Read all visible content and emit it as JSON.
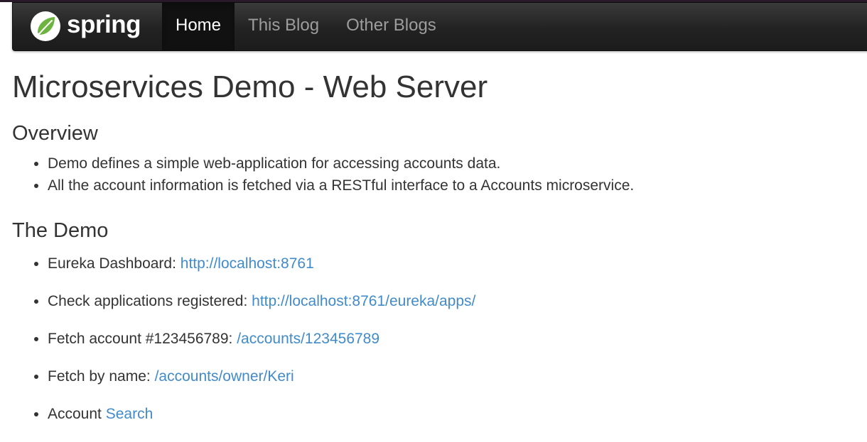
{
  "navbar": {
    "brand": "spring",
    "items": [
      {
        "label": "Home",
        "active": true
      },
      {
        "label": "This Blog",
        "active": false
      },
      {
        "label": "Other Blogs",
        "active": false
      }
    ]
  },
  "page": {
    "title": "Microservices Demo - Web Server"
  },
  "overview": {
    "heading": "Overview",
    "items": [
      "Demo defines a simple web-application for accessing accounts data.",
      "All the account information is fetched via a RESTful interface to a Accounts microservice."
    ]
  },
  "demo": {
    "heading": "The Demo",
    "items": [
      {
        "prefix": "Eureka Dashboard: ",
        "link": "http://localhost:8761"
      },
      {
        "prefix": "Check applications registered: ",
        "link": "http://localhost:8761/eureka/apps/"
      },
      {
        "prefix": "Fetch account #123456789: ",
        "link": "/accounts/123456789"
      },
      {
        "prefix": "Fetch by name: ",
        "link": "/accounts/owner/Keri"
      },
      {
        "prefix": "Account ",
        "link": "Search"
      }
    ]
  },
  "colors": {
    "link": "#428bca",
    "text": "#333333",
    "navbar": "#222222",
    "nav_inactive": "#9d9d9d",
    "brand_leaf": "#6db33f"
  },
  "icons": {
    "brand": "spring-leaf-icon"
  }
}
